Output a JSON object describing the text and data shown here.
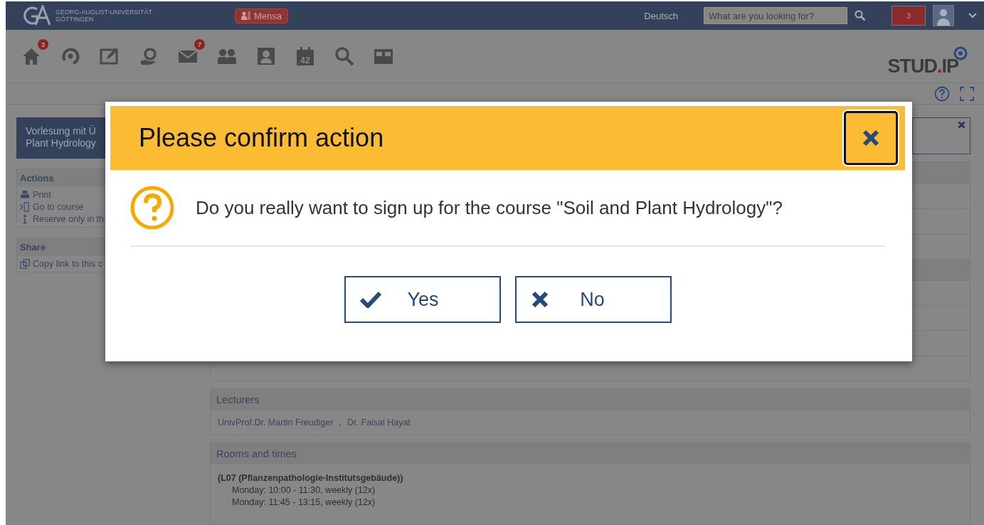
{
  "header": {
    "university": [
      "GEORG-AUGUST-UNIVERSITÄT",
      "GÖTTINGEN"
    ],
    "mensa": "Mensa",
    "language": "Deutsch",
    "search": {
      "placeholder": "What are you looking for?"
    },
    "notifications": "3"
  },
  "nav": [
    {
      "kind": "home",
      "badge": "3"
    },
    {
      "kind": "ring"
    },
    {
      "kind": "edit"
    },
    {
      "kind": "hand"
    },
    {
      "kind": "mail",
      "badge": "7"
    },
    {
      "kind": "people"
    },
    {
      "kind": "profile"
    },
    {
      "kind": "calendar",
      "day": "42"
    },
    {
      "kind": "search"
    },
    {
      "kind": "layout"
    }
  ],
  "logo": {
    "name": "STUD",
    "dot": ".",
    "suffix": "IP"
  },
  "sidebar": {
    "course_title": [
      "Vorlesung mit Ü",
      "Plant Hydrology"
    ],
    "widgets": [
      {
        "title": "Actions",
        "items": [
          {
            "kind": "print",
            "label": "Print"
          },
          {
            "kind": "enter",
            "label": "Go to course"
          },
          {
            "kind": "info",
            "label": "Reserve only in th"
          }
        ]
      },
      {
        "title": "Share",
        "items": [
          {
            "kind": "copy",
            "label": "Copy link to this c"
          }
        ]
      }
    ]
  },
  "main": {
    "lecturers": {
      "title": "Lecturers",
      "names": [
        "UnivProf.Dr. Martin Freudiger",
        "Dr. Faisal Hayat"
      ],
      "separator": ","
    },
    "rooms": {
      "title": "Rooms and times",
      "room": "(L07 (Pflanzenpathologie-Institutsgebäude))",
      "dates": [
        "Monday: 10:00 - 11:30, weekly (12x)",
        "Monday: 11:45 - 13:15, weekly (12x)"
      ]
    }
  },
  "dialog": {
    "title": "Please confirm action",
    "message": "Do you really want to sign up for the course \"Soil and Plant Hydrology\"?",
    "buttons": [
      {
        "kind": "yes",
        "label": "Yes"
      },
      {
        "kind": "no",
        "label": "No"
      }
    ]
  }
}
